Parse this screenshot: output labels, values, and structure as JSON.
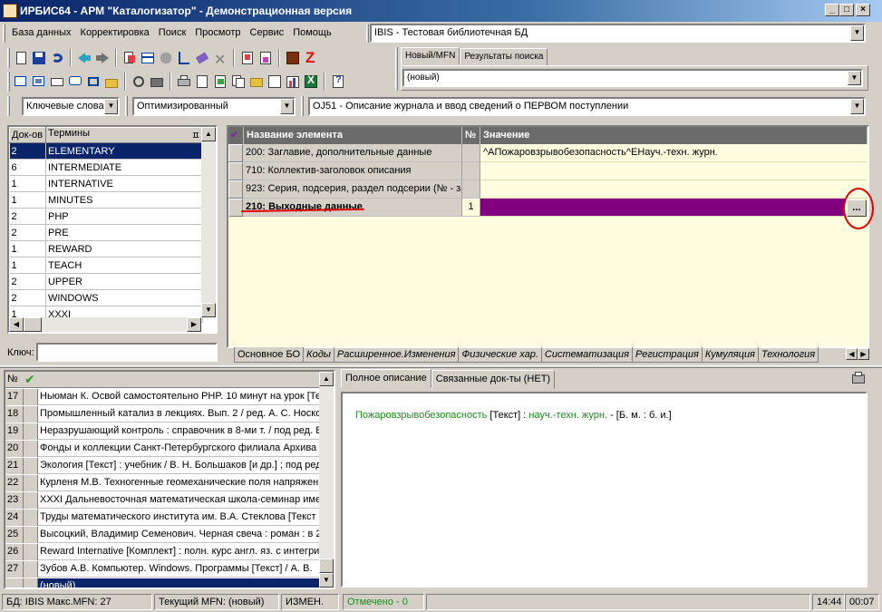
{
  "window": {
    "title": "ИРБИС64 - АРМ \"Каталогизатор\" - Демонстрационная версия"
  },
  "menu": [
    "База данных",
    "Корректировка",
    "Поиск",
    "Просмотр",
    "Сервис",
    "Помощь"
  ],
  "db_combo": {
    "value": "IBIS - Тестовая библиотечная БД"
  },
  "record_tabs": [
    "Новый/MFN",
    "Результаты поиска"
  ],
  "record_combo": {
    "value": "(новый)"
  },
  "dict_combo": {
    "value": "Ключевые слова"
  },
  "mode_combo": {
    "value": "Оптимизированный"
  },
  "worksheet_combo": {
    "value": "OJ51 - Описание журнала и ввод сведений о ПЕРВОМ поступлении"
  },
  "terms": {
    "headers": [
      "Док-ов",
      "Термины"
    ],
    "rows": [
      {
        "count": "2",
        "term": "ELEMENTARY"
      },
      {
        "count": "6",
        "term": "INTERMEDIATE"
      },
      {
        "count": "1",
        "term": "INTERNATIVE"
      },
      {
        "count": "1",
        "term": "MINUTES"
      },
      {
        "count": "2",
        "term": "PHP"
      },
      {
        "count": "2",
        "term": "PRE"
      },
      {
        "count": "1",
        "term": "REWARD"
      },
      {
        "count": "1",
        "term": "TEACH"
      },
      {
        "count": "2",
        "term": "UPPER"
      },
      {
        "count": "2",
        "term": "WINDOWS"
      },
      {
        "count": "1",
        "term": "XXXI"
      }
    ],
    "key_label": "Ключ:"
  },
  "grid": {
    "headers": [
      "Название элемента",
      "№",
      "Значение"
    ],
    "rows": [
      {
        "name": "200: Заглавие, дополнительные данные",
        "num": "",
        "value": "^AПожаровзрывобезопасность^EНауч.-техн. журн."
      },
      {
        "name": "710: Коллектив-заголовок описания",
        "num": "",
        "value": ""
      },
      {
        "name": "923: Серия, подсерия, раздел подсерии (№ - за",
        "num": "",
        "value": ""
      },
      {
        "name": "210: Выходные данные",
        "num": "1",
        "value": ""
      }
    ],
    "ellipsis": "..."
  },
  "bottom_tabs": [
    "Основное БО",
    "Коды",
    "Расширенное.Изменения",
    "Физические хар.",
    "Систематизация",
    "Регистрация",
    "Кумуляция",
    "Технология"
  ],
  "records": {
    "header_num": "№",
    "rows": [
      {
        "n": "17",
        "t": "Ньюман К. Освой самостоятельно PHP. 10 минут на урок [Те"
      },
      {
        "n": "18",
        "t": "Промышленный катализ в лекциях. Вып. 2 / ред. А. С. Носко"
      },
      {
        "n": "19",
        "t": "Неразрушающий контроль : справочник в 8-ми т. / под ред. В"
      },
      {
        "n": "20",
        "t": "Фонды и коллекции Санкт-Петербургского филиала Архива Р"
      },
      {
        "n": "21",
        "t": "Экология [Текст] : учебник / В. Н. Большаков [и др.] ; под ред."
      },
      {
        "n": "22",
        "t": "Курленя М.В. Техногенные геомеханические поля напряжен"
      },
      {
        "n": "23",
        "t": "XXXI Дальневосточная математическая школа-семинар име"
      },
      {
        "n": "24",
        "t": "Труды математического института им. В.А. Стеклова [Текст"
      },
      {
        "n": "25",
        "t": "Высоцкий, Владимир Семенович. Черная свеча : роман : в 2"
      },
      {
        "n": "26",
        "t": "Reward Internative [Комплект] : полн. курс англ. яз. с интегри"
      },
      {
        "n": "27",
        "t": "Зубов А.В. Компьютер. Windows. Программы [Текст] / А. В."
      }
    ],
    "new_row": "(новый)"
  },
  "desc_tabs": [
    "Полное описание",
    "Связанные док-ты (НЕТ)"
  ],
  "description": {
    "title": "Пожаровзрывобезопасность",
    "rest1": " [Текст] : ",
    "subtitle": "науч.-техн. журн.",
    "rest2": " - [Б. м. : б. и.]"
  },
  "status": {
    "db": "БД: IBIS Макс.MFN: 27",
    "mfn": "Текущий MFN: (новый)",
    "changed": "ИЗМЕН.",
    "marked": "Отмечено - 0",
    "time": "14:44",
    "clock": "00:07"
  }
}
